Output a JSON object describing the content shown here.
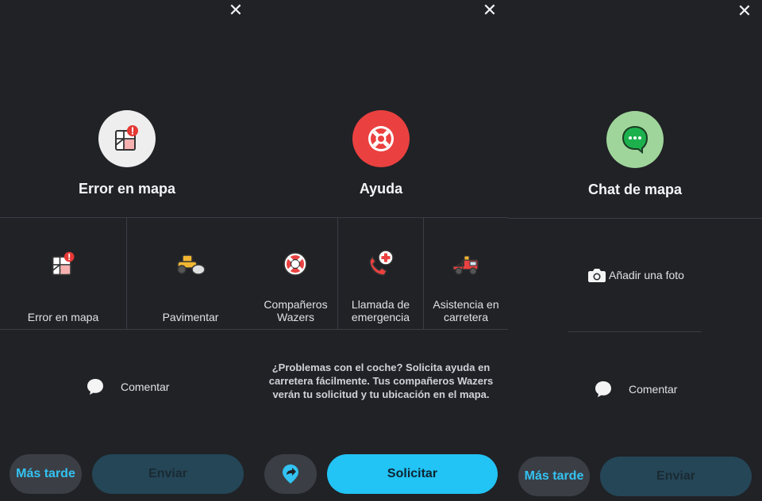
{
  "panels": {
    "error_map": {
      "title": "Error en mapa",
      "items": [
        {
          "label": "Error en mapa",
          "icon": "map-error-icon"
        },
        {
          "label": "Pavimentar",
          "icon": "paving-roller-icon"
        }
      ],
      "comment_label": "Comentar",
      "later_label": "Más tarde",
      "send_label": "Enviar"
    },
    "help": {
      "title": "Ayuda",
      "items": [
        {
          "label": "Compañeros Wazers",
          "icon": "lifebuoy-icon"
        },
        {
          "label": "Llamada de emergencia",
          "icon": "emergency-call-icon"
        },
        {
          "label": "Asistencia en carretera",
          "icon": "tow-truck-icon"
        }
      ],
      "description": "¿Problemas con el coche? Solicita ayuda en carretera fácilmente. Tus compañeros Wazers verán tu solicitud y tu ubicación en el mapa.",
      "request_label": "Solicitar",
      "share_icon": "share-location-icon"
    },
    "map_chat": {
      "title": "Chat de mapa",
      "add_photo_label": "Añadir una foto",
      "comment_label": "Comentar",
      "later_label": "Más tarde",
      "send_label": "Enviar"
    }
  },
  "colors": {
    "background": "#202226",
    "accent": "#22c3f5",
    "help_red": "#ea4140",
    "chat_green": "#9fd59a",
    "send_disabled": "#244657"
  },
  "close_glyph": "✕"
}
